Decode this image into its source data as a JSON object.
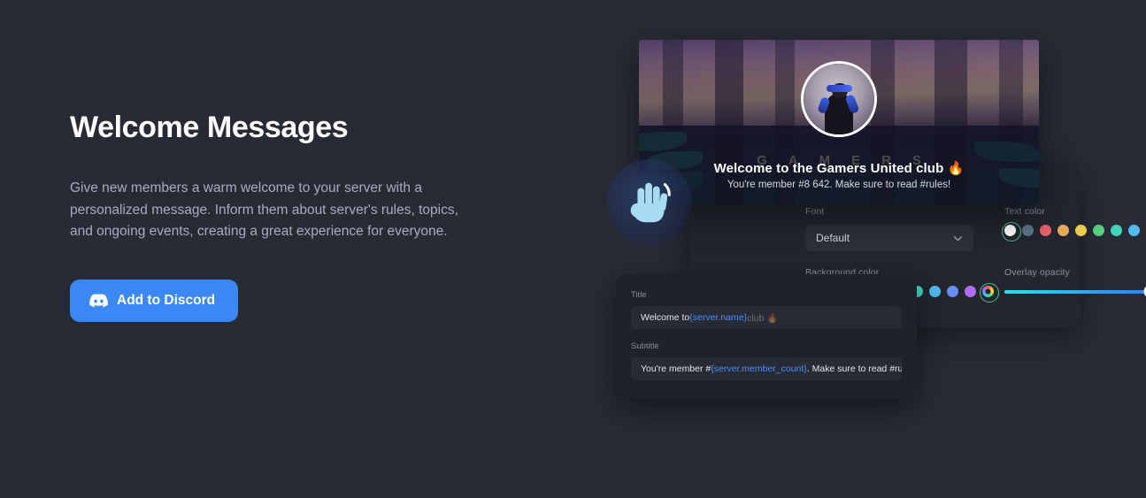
{
  "hero": {
    "title": "Welcome Messages",
    "description": "Give new members a warm welcome to your server with a personalized message. Inform them about server's rules, topics, and ongoing events, creating a great experience for everyone.",
    "cta_label": "Add to Discord",
    "cta_icon": "discord-icon",
    "accent_color": "#3b88f5"
  },
  "banner": {
    "title": "Welcome to the Gamers United club 🔥",
    "subtitle": "You're member #8 642. Make sure to read #rules!",
    "ghost_word": "GAMERS",
    "avatar_alt": "vr-gamer-avatar"
  },
  "hand_badge": {
    "icon": "waving-hand-icon"
  },
  "settings": {
    "font": {
      "label": "Font",
      "value": "Default",
      "chevron_icon": "chevron-down-icon"
    },
    "text_color": {
      "label": "Text color",
      "selected_index": 0,
      "swatches": [
        "#ffffff",
        "#5b7487",
        "#e8626f",
        "#e8a95a",
        "#e8cc4e",
        "#56cc7e",
        "#43d3bb",
        "#4fbaf0",
        "#6a8cf5",
        "#b06cf0"
      ],
      "custom_label": "rainbow-picker-icon"
    },
    "background_color": {
      "label": "Background color",
      "selected_index": 10,
      "swatches": [
        "#ffffff",
        "#5b7487",
        "#f2655f",
        "#f0a94e",
        "#f5cc45",
        "#4fcb7d",
        "#3fd6bc",
        "#4fbbf2",
        "#6a8cf7",
        "#b06cf5"
      ],
      "custom_label": "rainbow-picker-icon"
    },
    "overlay_opacity": {
      "label": "Overlay opacity",
      "value_percent": 86
    }
  },
  "fields": {
    "title": {
      "label": "Title",
      "text_prefix": "Welcome to ",
      "variable": "{server.name}",
      "text_suffix": " club 🔥"
    },
    "subtitle": {
      "label": "Subtitle",
      "text_prefix": "You're member #",
      "variable": "{server.member_count}",
      "text_suffix": ". Make sure to read #rules!"
    }
  }
}
